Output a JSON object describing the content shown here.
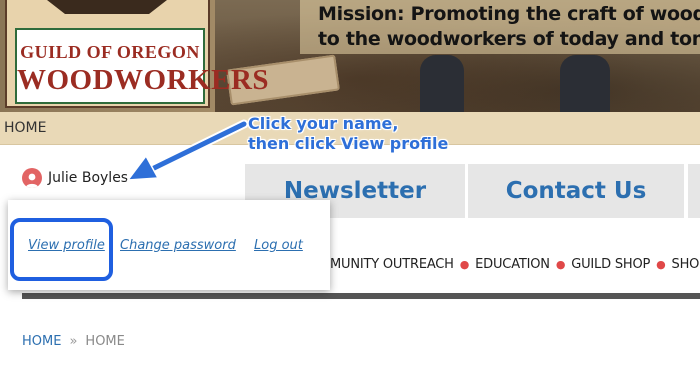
{
  "header": {
    "logo_line1": "GUILD OF OREGON",
    "logo_line2": "WOODWORKERS",
    "mission_line1": "Mission: Promoting the craft of woodw",
    "mission_line2": "to the woodworkers of today and tomo"
  },
  "home_strip": {
    "label": "HOME"
  },
  "callout": {
    "line1": "Click your name,",
    "line2": "then click View profile",
    "color": "#2e6fd8"
  },
  "user": {
    "name": "Julie Boyles",
    "avatar_icon": "user-icon"
  },
  "buttons": {
    "newsletter": "Newsletter",
    "contact": "Contact Us"
  },
  "dropdown": {
    "view_profile": "View profile",
    "change_password": "Change password",
    "log_out": "Log out"
  },
  "menu": {
    "items": [
      "MUNITY OUTREACH",
      "EDUCATION",
      "GUILD SHOP",
      "SHOP"
    ],
    "separator": "●"
  },
  "breadcrumb": {
    "home": "HOME",
    "separator": "»",
    "current": "HOME"
  },
  "colors": {
    "link": "#2c6fb0",
    "accent_dot": "#e04848",
    "highlight": "#1f5fe0"
  }
}
